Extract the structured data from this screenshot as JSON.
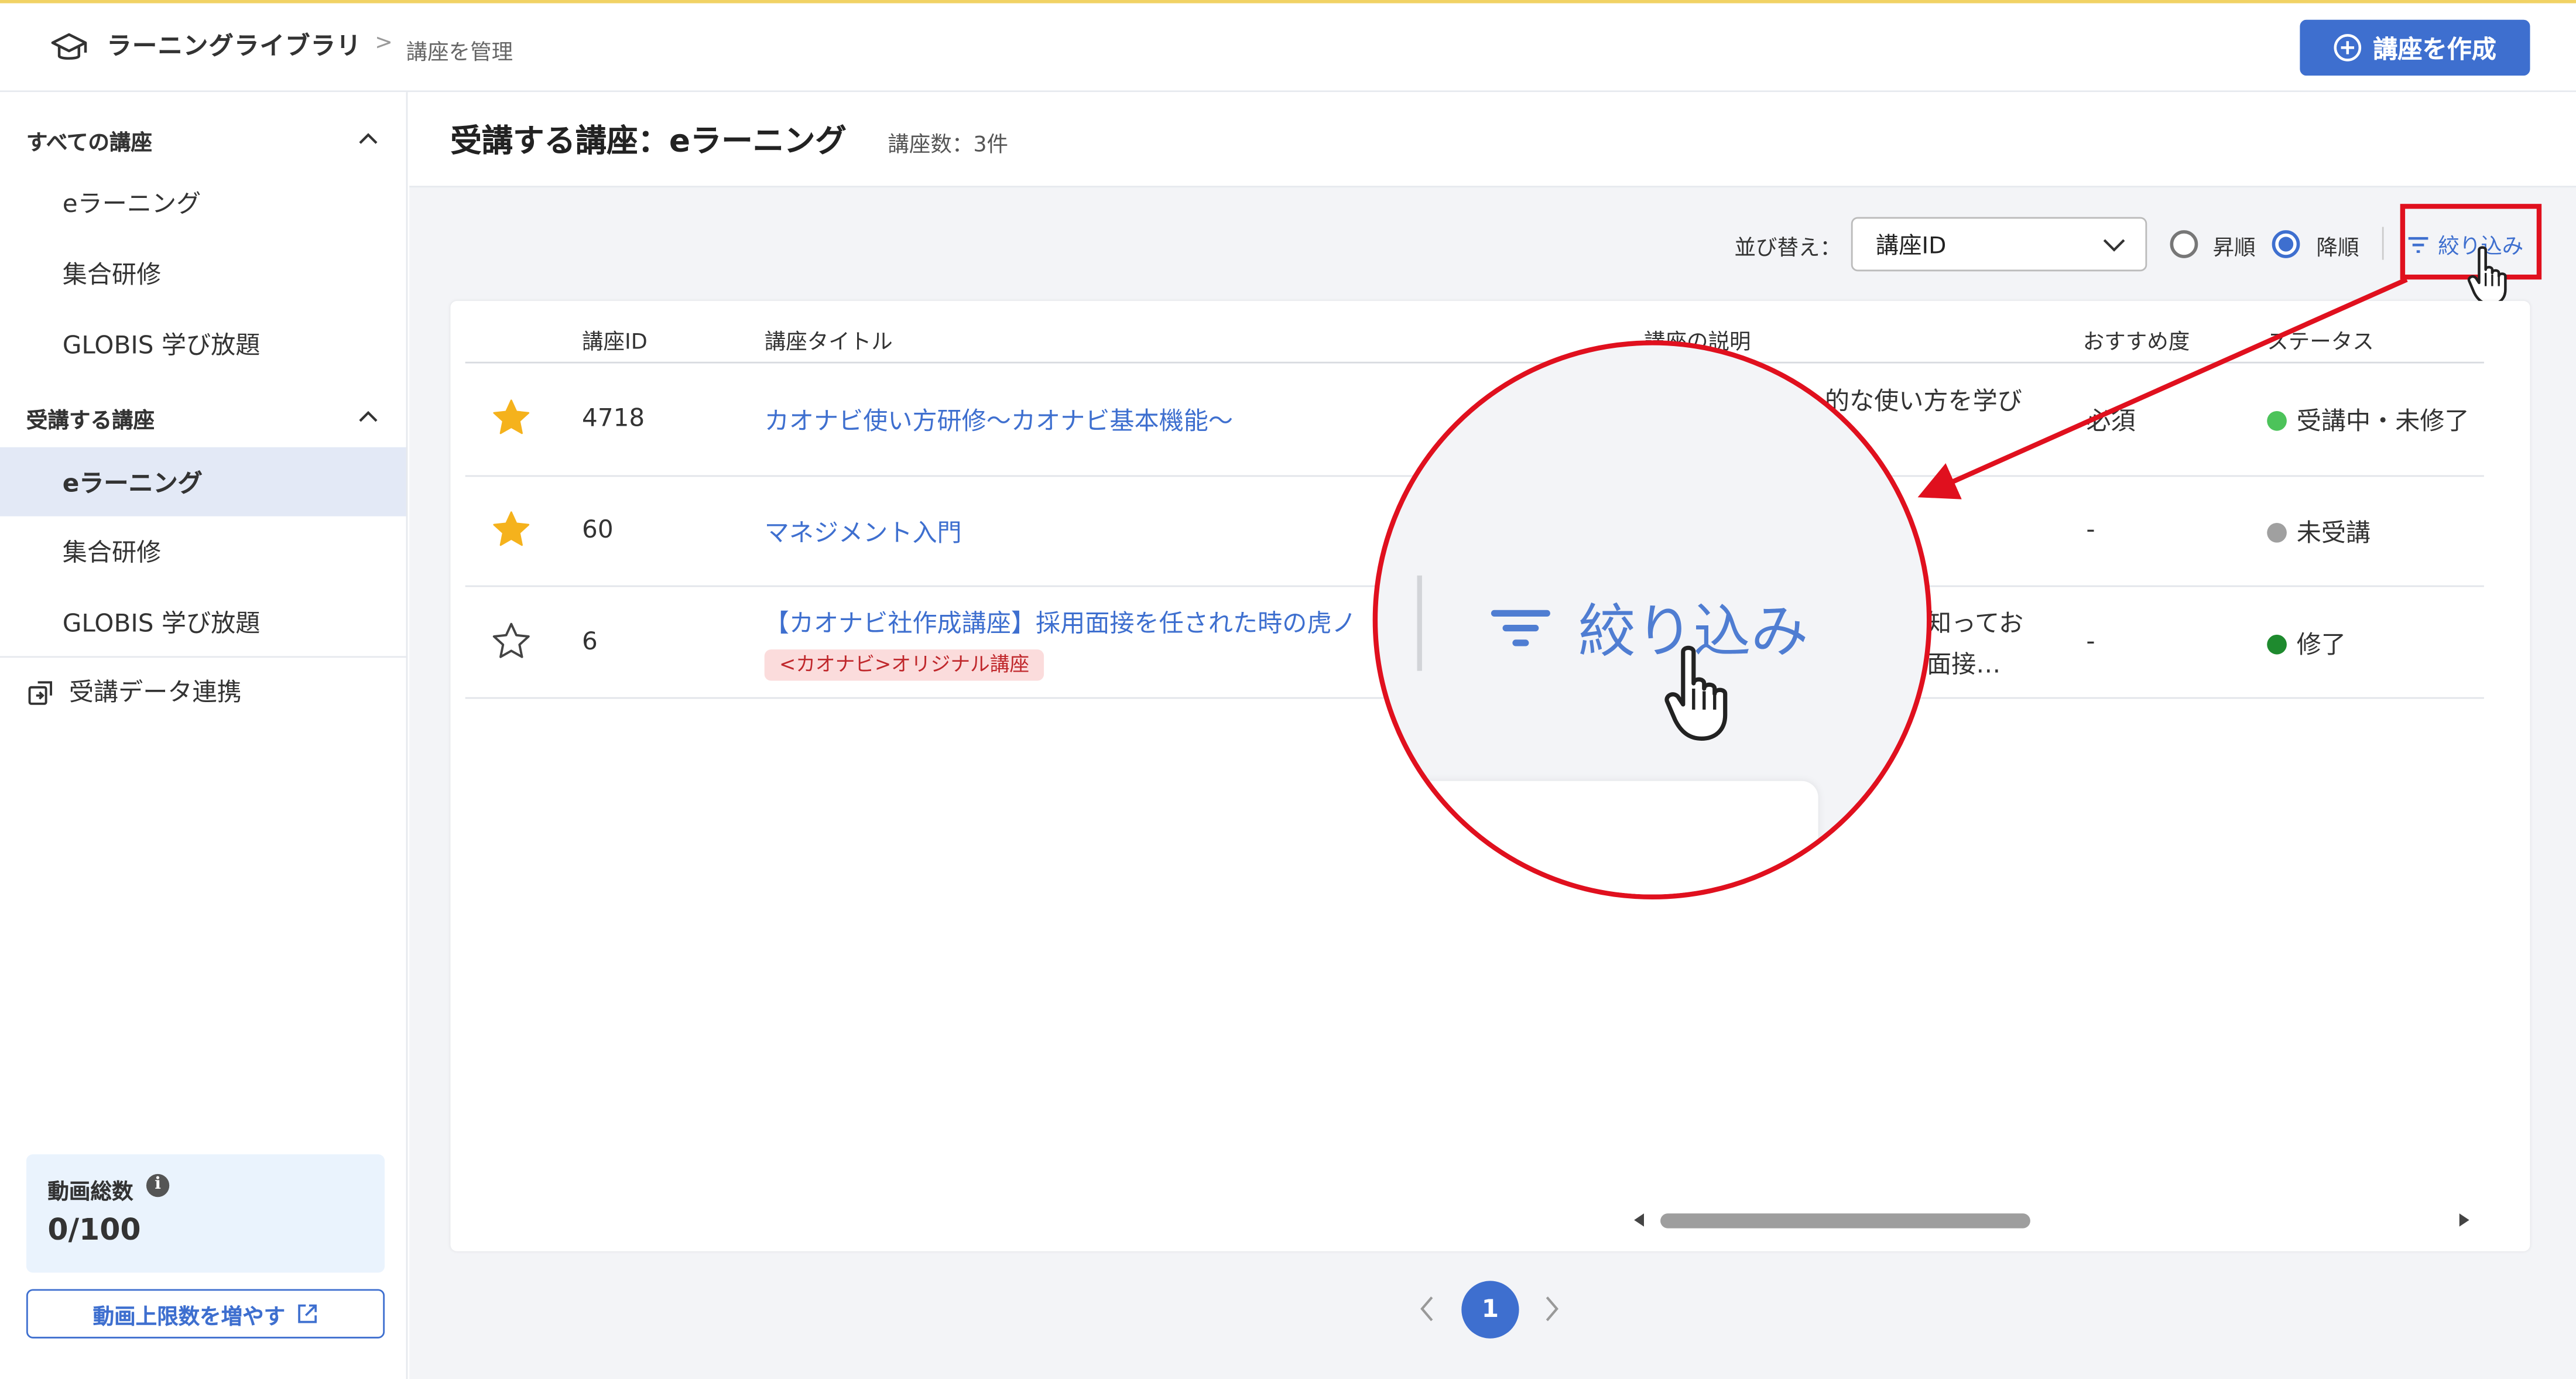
{
  "header": {
    "app_title": "ラーニングライブラリ",
    "breadcrumb_separator": ">",
    "breadcrumb_page": "講座を管理",
    "create_button": "講座を作成"
  },
  "sidebar": {
    "all_courses": {
      "title": "すべての講座",
      "items": [
        "eラーニング",
        "集合研修",
        "GLOBIS 学び放題"
      ]
    },
    "taking_courses": {
      "title": "受講する講座",
      "items": [
        "eラーニング",
        "集合研修",
        "GLOBIS 学び放題"
      ],
      "active_item": "eラーニング"
    },
    "sync_link": "受講データ連携",
    "video_quota": {
      "label": "動画総数",
      "value": "0/100",
      "info_icon": "i"
    },
    "increase_button": "動画上限数を増やす"
  },
  "main": {
    "page_title": "受講する講座：eラーニング",
    "course_count": "講座数：3件",
    "sort": {
      "label": "並び替え：",
      "selected": "講座ID",
      "ascending": "昇順",
      "descending": "降順",
      "selected_order": "降順"
    },
    "filter_button": "絞り込み",
    "table": {
      "columns": [
        "講座ID",
        "講座タイトル",
        "講座の説明",
        "おすすめ度",
        "ステータス"
      ],
      "rows": [
        {
          "favorite": true,
          "id": "4718",
          "title": "カオナビ使い方研修～カオナビ基本機能～",
          "description": "的な使い方を学び",
          "recommend": "必須",
          "status": "受講中・未修了",
          "status_color": "#4cc35a"
        },
        {
          "favorite": true,
          "id": "60",
          "title": "マネジメント入門",
          "description": "",
          "recommend": "-",
          "status": "未受講",
          "status_color": "#a0a0a0"
        },
        {
          "favorite": false,
          "id": "6",
          "title": "【カオナビ社作成講座】採用面接を任された時の虎ノ",
          "tag": "<カオナビ>オリジナル講座",
          "description_line1": "知ってお",
          "description_line2": "面接…",
          "recommend": "-",
          "status": "修了",
          "status_color": "#1e8a2e"
        }
      ]
    },
    "pagination": {
      "current": "1"
    }
  },
  "zoom": {
    "filter_label": "絞り込み"
  },
  "colors": {
    "accent": "#3e6fcf",
    "highlight": "#e0101e",
    "star": "#f5b21c"
  }
}
